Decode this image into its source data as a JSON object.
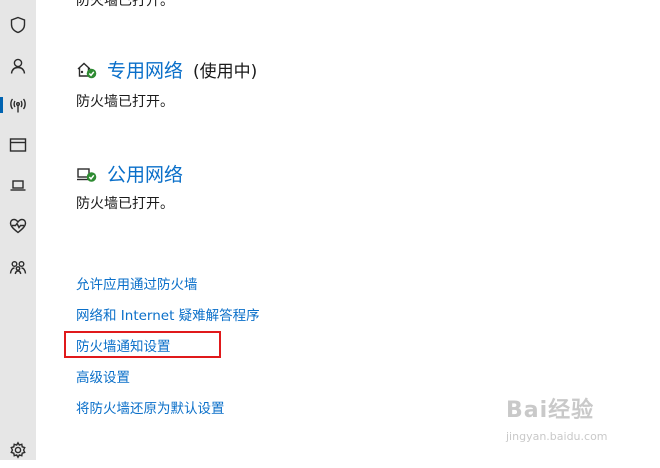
{
  "sidebar": {
    "items": [
      {
        "name": "shield-icon",
        "active": false
      },
      {
        "name": "person-icon",
        "active": false
      },
      {
        "name": "antenna-icon",
        "active": true
      },
      {
        "name": "app-window-icon",
        "active": false
      },
      {
        "name": "laptop-icon",
        "active": false
      },
      {
        "name": "heart-pulse-icon",
        "active": false
      },
      {
        "name": "family-icon",
        "active": false
      },
      {
        "name": "gear-icon",
        "active": false
      }
    ]
  },
  "top_partial_status": "防火墙已打开。",
  "private_network": {
    "icon": "private-network-icon",
    "title": "专用网络",
    "suffix": "(使用中)",
    "status": "防火墙已打开。"
  },
  "public_network": {
    "icon": "public-network-icon",
    "title": "公用网络",
    "status": "防火墙已打开。"
  },
  "links": {
    "allow_app": "允许应用通过防火墙",
    "troubleshooter": "网络和 Internet 疑难解答程序",
    "notification_settings": "防火墙通知设置",
    "advanced_settings": "高级设置",
    "restore_defaults": "将防火墙还原为默认设置"
  },
  "colors": {
    "link": "#0a6fc9",
    "highlight": "#e0191b",
    "sidebar_bg": "#e6e6e6",
    "check_green": "#2e8b32"
  },
  "watermark": {
    "logo": "Bai经验",
    "url": "jingyan.baidu.com"
  }
}
